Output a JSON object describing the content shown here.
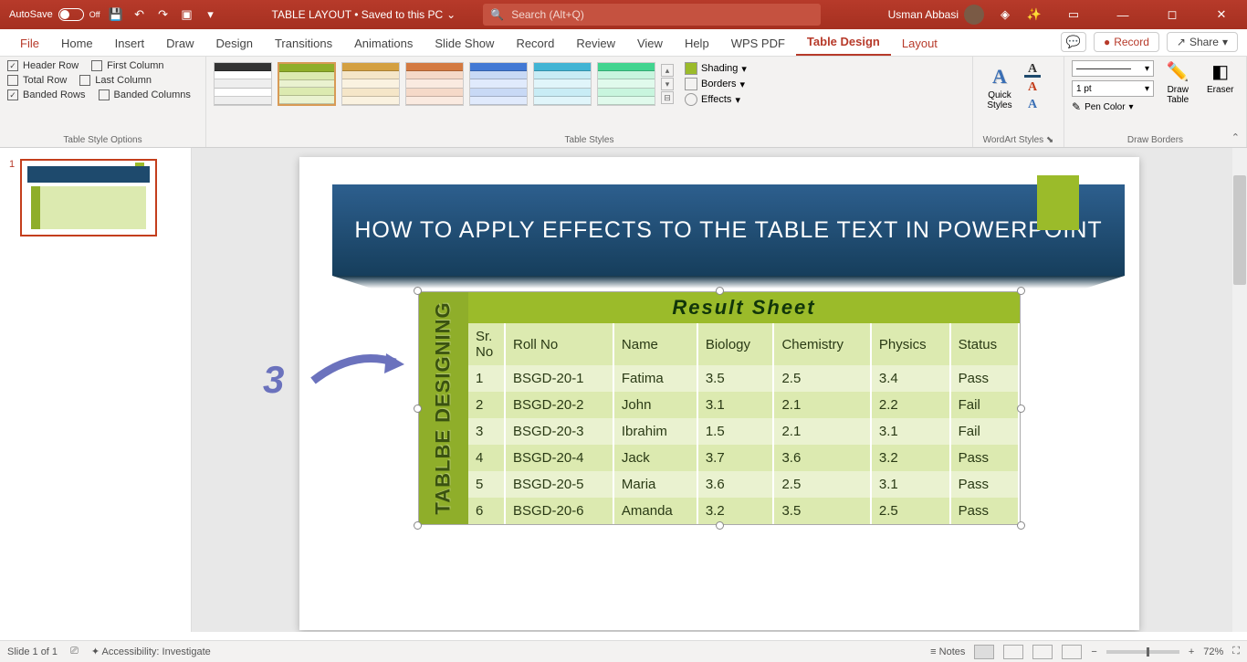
{
  "titlebar": {
    "autosave_label": "AutoSave",
    "autosave_state": "Off",
    "doc_title": "TABLE LAYOUT • Saved to this PC",
    "search_placeholder": "Search (Alt+Q)",
    "user_name": "Usman Abbasi"
  },
  "tabs": {
    "file": "File",
    "home": "Home",
    "insert": "Insert",
    "draw": "Draw",
    "design": "Design",
    "transitions": "Transitions",
    "animations": "Animations",
    "slideshow": "Slide Show",
    "record": "Record",
    "review": "Review",
    "view": "View",
    "help": "Help",
    "wps": "WPS PDF",
    "tabledesign": "Table Design",
    "layout": "Layout",
    "record_btn": "Record",
    "share_btn": "Share"
  },
  "ribbon": {
    "style_options": {
      "header_row": "Header Row",
      "first_col": "First Column",
      "total_row": "Total Row",
      "last_col": "Last Column",
      "banded_rows": "Banded Rows",
      "banded_cols": "Banded Columns",
      "group_label": "Table Style Options"
    },
    "table_styles_label": "Table Styles",
    "shading": "Shading",
    "borders": "Borders",
    "effects": "Effects",
    "quick_styles": "Quick Styles",
    "wordart_label": "WordArt Styles",
    "pen_weight": "1 pt",
    "pen_color": "Pen Color",
    "draw_table": "Draw Table",
    "eraser": "Eraser",
    "draw_borders_label": "Draw Borders"
  },
  "slide": {
    "number": "1",
    "banner_title": "HOW TO APPLY EFFECTS TO THE TABLE TEXT IN POWERPOINT",
    "annotation": "3",
    "table": {
      "side_label": "TABLBE DESIGNING",
      "title": "Result  Sheet",
      "headers": [
        "Sr. No",
        "Roll No",
        "Name",
        "Biology",
        "Chemistry",
        "Physics",
        "Status"
      ],
      "rows": [
        [
          "1",
          "BSGD-20-1",
          "Fatima",
          "3.5",
          "2.5",
          "3.4",
          "Pass"
        ],
        [
          "2",
          "BSGD-20-2",
          "John",
          "3.1",
          "2.1",
          "2.2",
          "Fail"
        ],
        [
          "3",
          "BSGD-20-3",
          "Ibrahim",
          "1.5",
          "2.1",
          "3.1",
          "Fail"
        ],
        [
          "4",
          "BSGD-20-4",
          "Jack",
          "3.7",
          "3.6",
          "3.2",
          "Pass"
        ],
        [
          "5",
          "BSGD-20-5",
          "Maria",
          "3.6",
          "2.5",
          "3.1",
          "Pass"
        ],
        [
          "6",
          "BSGD-20-6",
          "Amanda",
          "3.2",
          "3.5",
          "2.5",
          "Pass"
        ]
      ]
    }
  },
  "statusbar": {
    "slide_info": "Slide 1 of 1",
    "accessibility": "Accessibility: Investigate",
    "notes": "Notes",
    "zoom": "72%"
  }
}
